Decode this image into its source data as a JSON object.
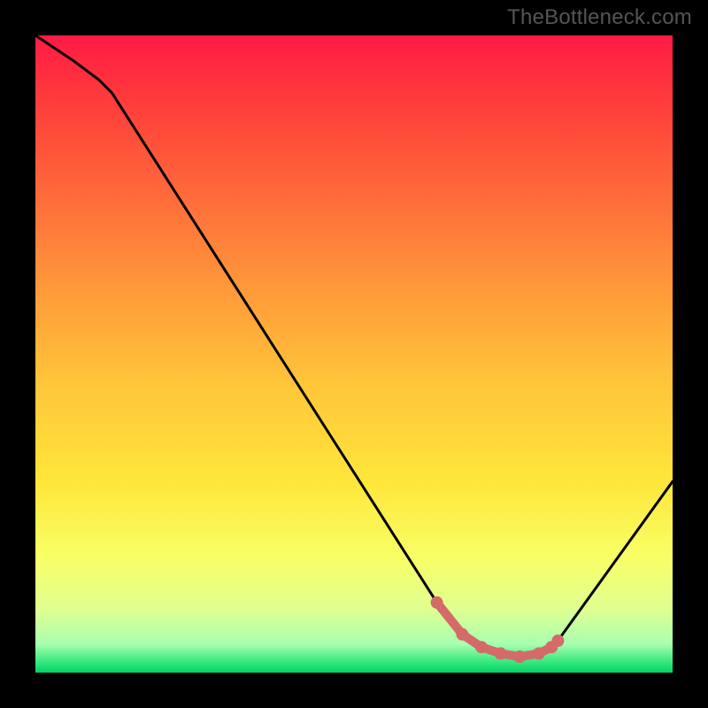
{
  "watermark": "TheBottleneck.com",
  "chart_data": {
    "type": "line",
    "title": "",
    "xlabel": "",
    "ylabel": "",
    "xlim": [
      0,
      100
    ],
    "ylim": [
      0,
      100
    ],
    "series": [
      {
        "name": "curve",
        "x": [
          0,
          6,
          8,
          10,
          12,
          63,
          67,
          70,
          73,
          76,
          79,
          81,
          82,
          100
        ],
        "values": [
          100,
          96,
          94.5,
          93,
          91,
          11,
          6,
          4,
          3,
          2.5,
          3,
          4,
          5,
          30
        ]
      },
      {
        "name": "highlight",
        "x": [
          63,
          67,
          70,
          73,
          76,
          79,
          81,
          82
        ],
        "values": [
          11,
          6,
          4,
          3,
          2.5,
          3,
          4,
          5
        ]
      }
    ],
    "background_gradient_stops": [
      {
        "pos": 0.0,
        "color": "#ff1a44"
      },
      {
        "pos": 0.1,
        "color": "#ff3b3b"
      },
      {
        "pos": 0.25,
        "color": "#ff6a3a"
      },
      {
        "pos": 0.4,
        "color": "#ff9a3a"
      },
      {
        "pos": 0.55,
        "color": "#ffc63a"
      },
      {
        "pos": 0.7,
        "color": "#ffe63a"
      },
      {
        "pos": 0.82,
        "color": "#f8ff66"
      },
      {
        "pos": 0.9,
        "color": "#e0ff90"
      },
      {
        "pos": 0.955,
        "color": "#a8ffb0"
      },
      {
        "pos": 0.985,
        "color": "#30e67a"
      },
      {
        "pos": 1.0,
        "color": "#00d267"
      }
    ],
    "highlight_color": "#d46a6a",
    "curve_color": "#000000"
  }
}
